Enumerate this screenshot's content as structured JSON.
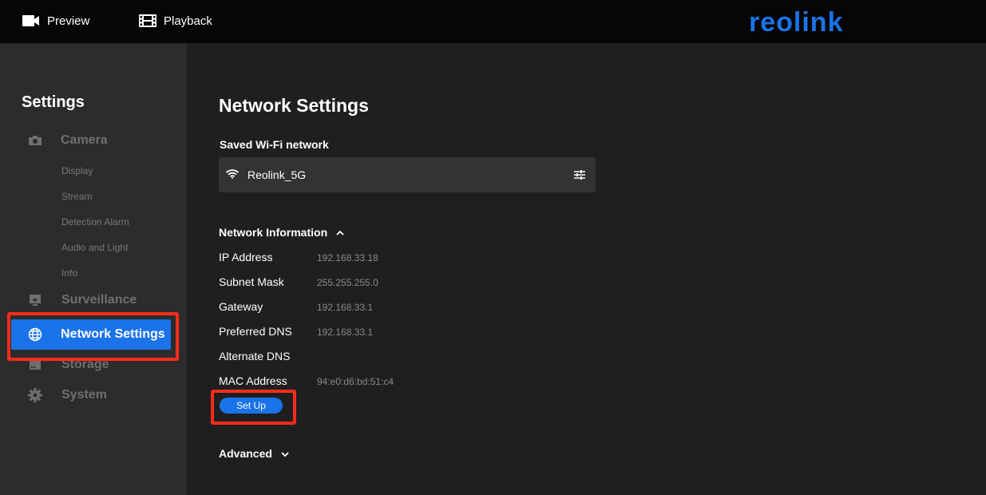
{
  "topbar": {
    "preview_label": "Preview",
    "playback_label": "Playback",
    "preview_icon": "video-camera-icon",
    "playback_icon": "film-strip-icon",
    "logo_text": "reolink",
    "logo_color": "#1a73e8"
  },
  "sidebar": {
    "title": "Settings",
    "camera": {
      "label": "Camera",
      "icon": "camera-icon"
    },
    "camera_items": [
      "Display",
      "Stream",
      "Detection Alarm",
      "Audio and Light",
      "Info"
    ],
    "surveillance": {
      "label": "Surveillance",
      "icon": "monitor-icon"
    },
    "network": {
      "label": "Network Settings",
      "icon": "globe-icon",
      "active": true
    },
    "storage": {
      "label": "Storage",
      "icon": "storage-icon"
    },
    "system": {
      "label": "System",
      "icon": "gear-icon"
    }
  },
  "main": {
    "title": "Network Settings",
    "saved_wifi_title": "Saved Wi-Fi network",
    "wifi_name": "Reolink_5G",
    "network_info_title": "Network Information",
    "network_info_rows": [
      {
        "label": "IP Address",
        "value": "192.168.33.18"
      },
      {
        "label": "Subnet Mask",
        "value": "255.255.255.0"
      },
      {
        "label": "Gateway",
        "value": "192.168.33.1"
      },
      {
        "label": "Preferred DNS",
        "value": "192.168.33.1"
      },
      {
        "label": "Alternate DNS",
        "value": ""
      },
      {
        "label": "MAC Address",
        "value": "94:e0:d6:bd:51:c4"
      }
    ],
    "setup_button": "Set Up",
    "advanced_title": "Advanced"
  },
  "colors": {
    "accent": "#1a73e8",
    "highlight": "#ff2b1c"
  }
}
